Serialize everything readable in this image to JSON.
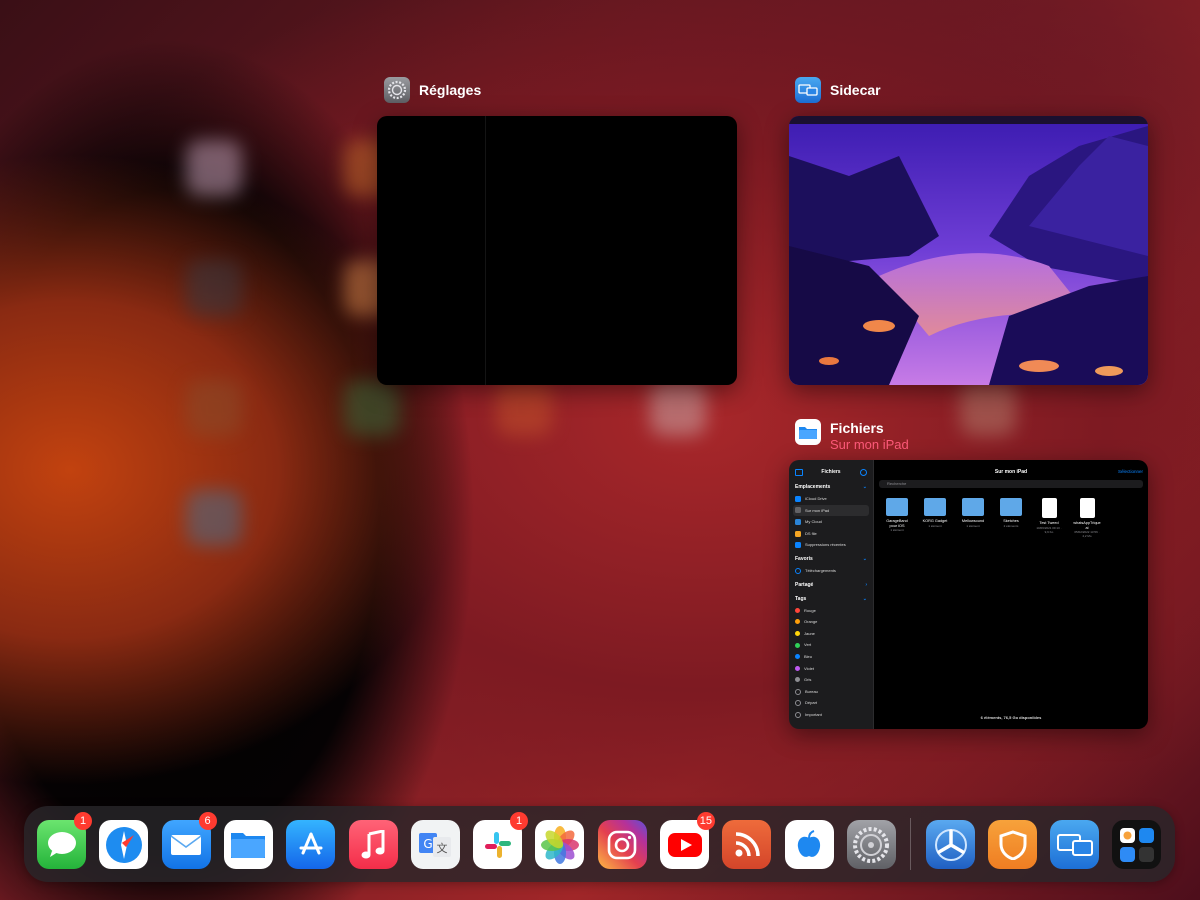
{
  "app_switcher": {
    "cards": [
      {
        "id": "reglages",
        "title": "Réglages",
        "icon": "gear-icon"
      },
      {
        "id": "sidecar",
        "title": "Sidecar",
        "icon": "sidecar-icon"
      },
      {
        "id": "fichiers",
        "title": "Fichiers",
        "subtitle": "Sur mon iPad",
        "icon": "folder-icon"
      }
    ]
  },
  "files_window": {
    "sidebar_title": "Fichiers",
    "locations_header": "Emplacements",
    "locations": [
      "iCloud Drive",
      "Sur mon iPad",
      "My Cloud",
      "DS file",
      "Suppressions récentes"
    ],
    "favorites_header": "Favoris",
    "favorites": [
      "Téléchargements"
    ],
    "shared_header": "Partagé",
    "tags_header": "Tags",
    "tags": [
      {
        "name": "Rouge",
        "color": "#ff453a"
      },
      {
        "name": "Orange",
        "color": "#ff9f0a"
      },
      {
        "name": "Jaune",
        "color": "#ffd60a"
      },
      {
        "name": "Vert",
        "color": "#30d158"
      },
      {
        "name": "Bleu",
        "color": "#0a84ff"
      },
      {
        "name": "Violet",
        "color": "#bf5af2"
      },
      {
        "name": "Gris",
        "color": "#8e8e93"
      },
      {
        "name": "Bureau",
        "color": ""
      },
      {
        "name": "Départ",
        "color": ""
      },
      {
        "name": "Important",
        "color": ""
      }
    ],
    "main_title": "Sur mon iPad",
    "select_label": "Sélectionner",
    "search_placeholder": "Recherche",
    "files": [
      {
        "name": "GarageBand pour iOS",
        "meta": "1 élément"
      },
      {
        "name": "KORG Gadget",
        "meta": "1 élément"
      },
      {
        "name": "Mellowsound",
        "meta": "1 élément"
      },
      {
        "name": "Sketches",
        "meta": "2 éléments"
      },
      {
        "name": "Test Tweed",
        "meta": "10/06/2021 09:10 · 9,9 Ko"
      },
      {
        "name": "whatsAppTrique ai",
        "meta": "05/02/2022 13:56 · 4,2 Mo"
      }
    ],
    "footer": "6 éléments, 76,5 Go disponibles"
  },
  "dock": {
    "apps": [
      {
        "name": "Messages",
        "icon": "messages-icon",
        "badge": "1"
      },
      {
        "name": "Safari",
        "icon": "safari-icon",
        "badge": ""
      },
      {
        "name": "Mail",
        "icon": "mail-icon",
        "badge": "6"
      },
      {
        "name": "Fichiers",
        "icon": "files-icon",
        "badge": ""
      },
      {
        "name": "App Store",
        "icon": "app-store-icon",
        "badge": ""
      },
      {
        "name": "Musique",
        "icon": "music-icon",
        "badge": ""
      },
      {
        "name": "Google Traduction",
        "icon": "translate-icon",
        "badge": ""
      },
      {
        "name": "Slack",
        "icon": "slack-icon",
        "badge": "1"
      },
      {
        "name": "Photos",
        "icon": "photos-icon",
        "badge": ""
      },
      {
        "name": "Instagram",
        "icon": "instagram-icon",
        "badge": ""
      },
      {
        "name": "YouTube",
        "icon": "youtube-icon",
        "badge": "15"
      },
      {
        "name": "Flux RSS",
        "icon": "rss-icon",
        "badge": ""
      },
      {
        "name": "iGeneration",
        "icon": "apple-news-icon",
        "badge": ""
      },
      {
        "name": "Réglages",
        "icon": "settings-icon",
        "badge": ""
      },
      {
        "name": "TestFlight",
        "icon": "testflight-icon",
        "badge": ""
      },
      {
        "name": "VPN",
        "icon": "shield-icon",
        "badge": ""
      },
      {
        "name": "Sidecar",
        "icon": "sidecar-icon",
        "badge": ""
      },
      {
        "name": "App Library",
        "icon": "app-library-icon",
        "badge": ""
      }
    ]
  }
}
